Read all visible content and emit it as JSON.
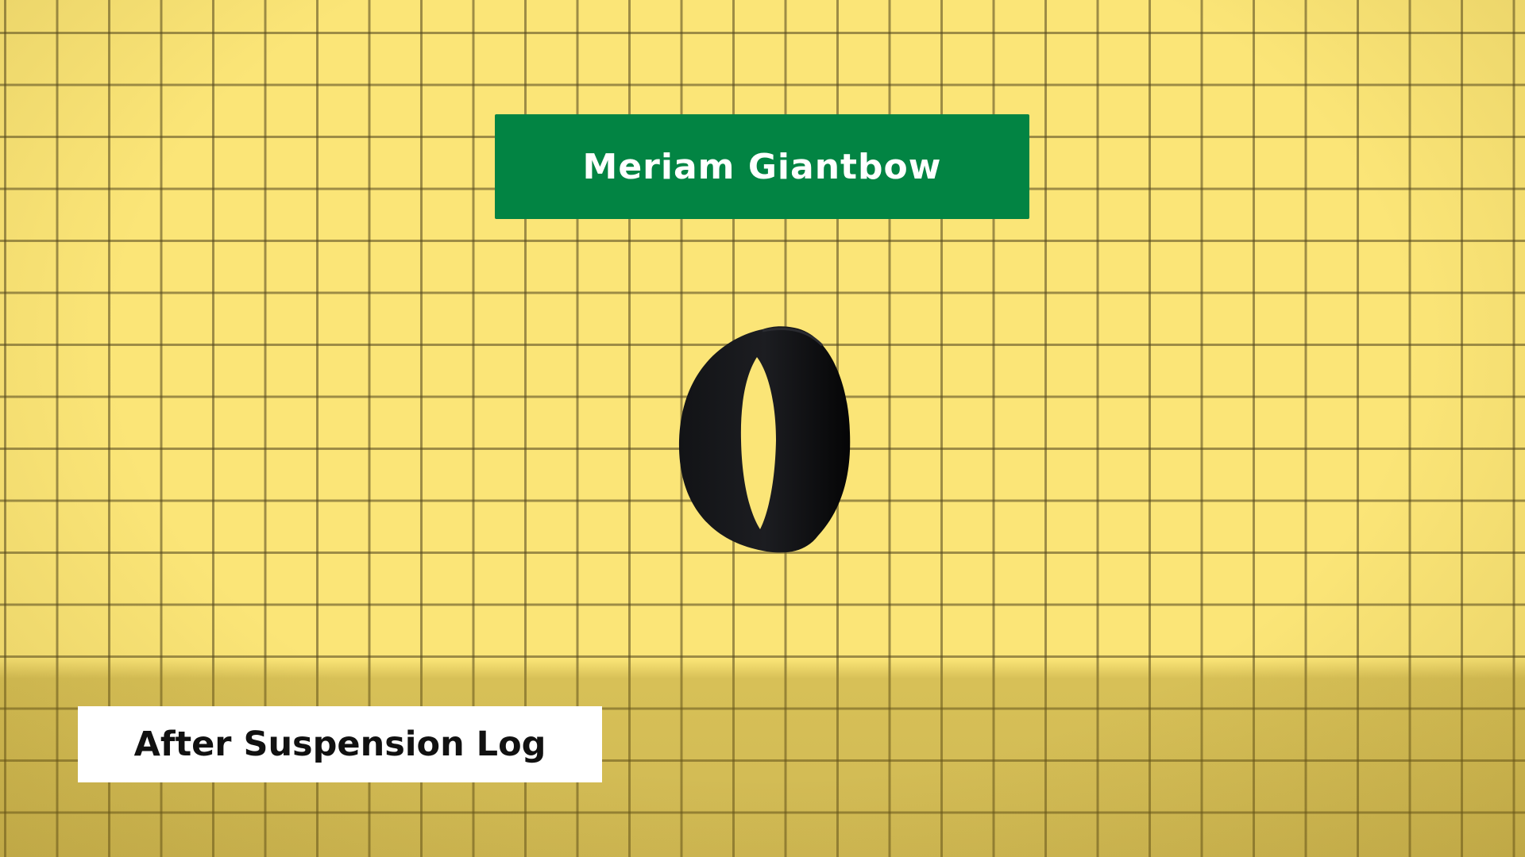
{
  "item": {
    "name": "Meriam Giantbow",
    "model_icon": "black-ring-band"
  },
  "caption": {
    "label": "After Suspension Log"
  },
  "colors": {
    "background": "#fbe577",
    "grid_line": "#50441c",
    "title_banner": "#028443",
    "title_text": "#ffffff",
    "caption_box": "#ffffff",
    "caption_text": "#111111",
    "item": "#0a0a0a"
  }
}
